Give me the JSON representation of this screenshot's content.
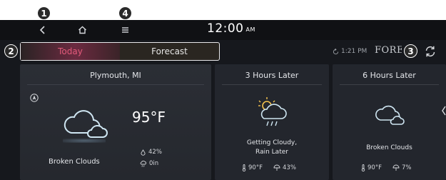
{
  "callouts": [
    "1",
    "2",
    "3",
    "4"
  ],
  "header": {
    "time": "12:00",
    "ampm": "AM"
  },
  "nav": {
    "back_icon": "back-arrow-icon",
    "home_icon": "home-icon",
    "menu_icon": "menu-icon"
  },
  "tabs": [
    {
      "label": "Today",
      "active": true
    },
    {
      "label": "Forecast",
      "active": false
    }
  ],
  "status": {
    "updated_time": "1:21 PM",
    "brand": "FORECA"
  },
  "today": {
    "location": "Plymouth, MI",
    "temperature": "95°F",
    "condition": "Broken Clouds",
    "humidity": "42%",
    "precipitation": "0in"
  },
  "forecasts": [
    {
      "title": "3 Hours Later",
      "condition_line1": "Getting Cloudy,",
      "condition_line2": "Rain Later",
      "temperature": "90°F",
      "precip_chance": "43%"
    },
    {
      "title": "6 Hours Later",
      "condition_line1": "Broken Clouds",
      "condition_line2": "",
      "temperature": "90°F",
      "precip_chance": "7%"
    }
  ],
  "colors": {
    "accent": "#e25a7a",
    "background": "#16181d",
    "card": "#23262d"
  }
}
